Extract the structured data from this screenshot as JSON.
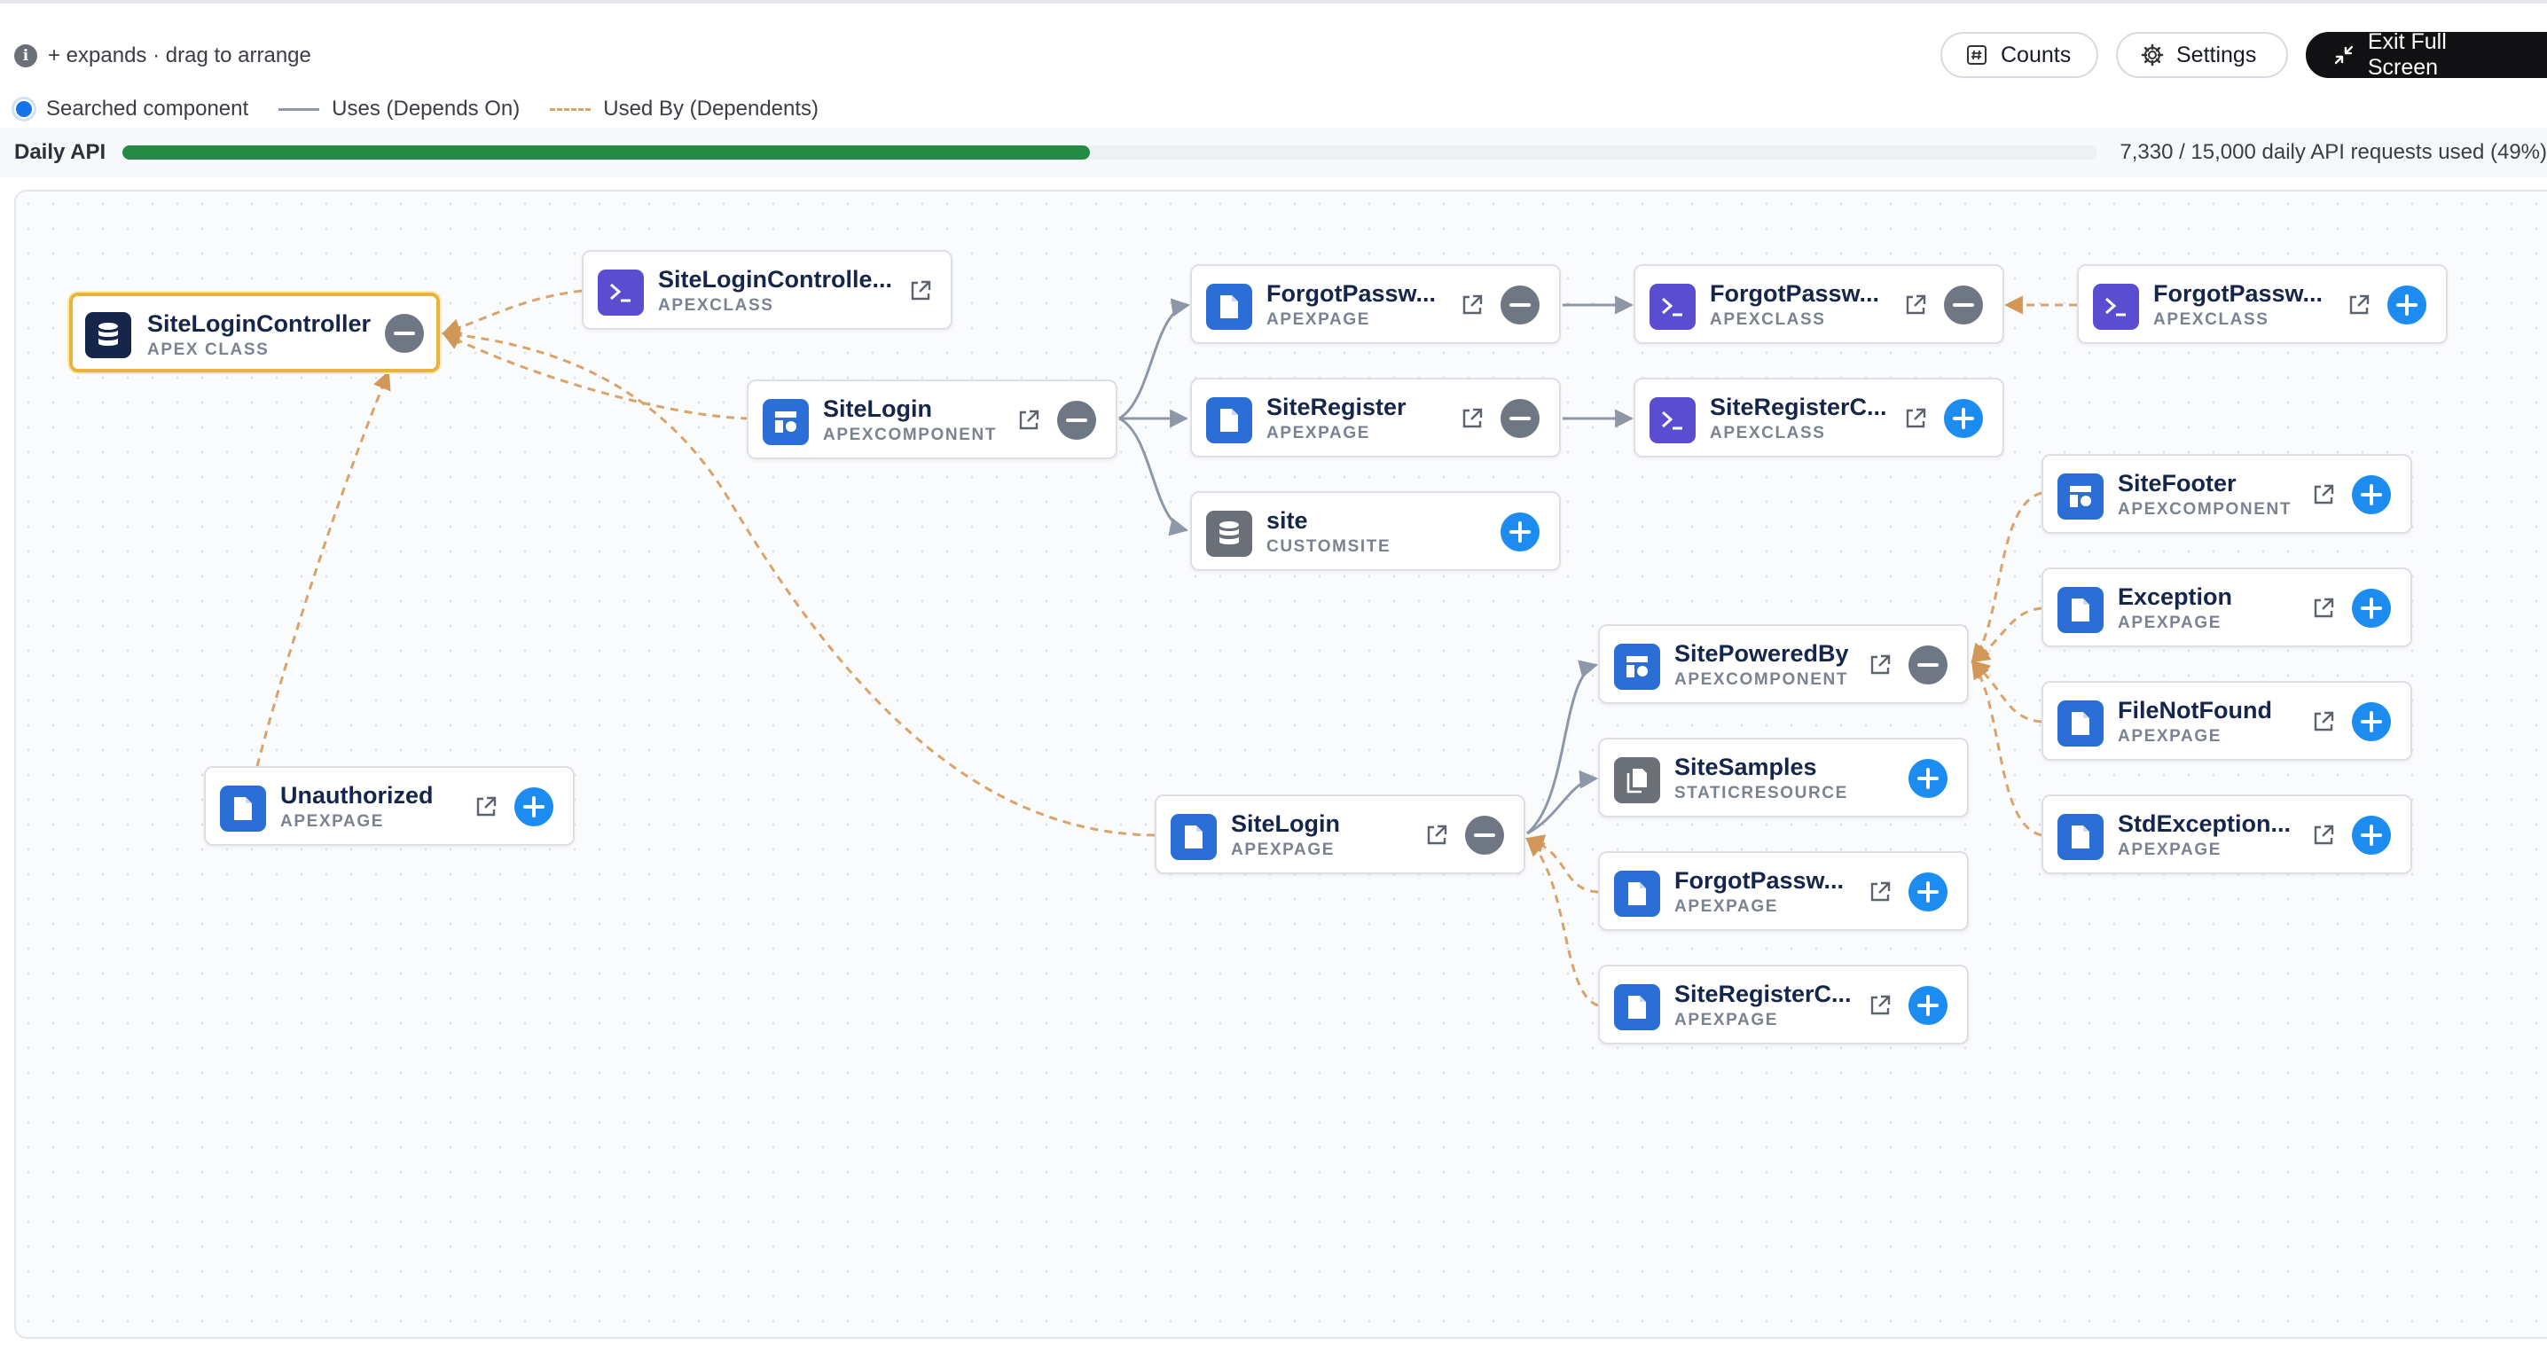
{
  "hint": {
    "text": "+ expands · drag to arrange"
  },
  "legend": {
    "searched": "Searched component",
    "uses": "Uses (Depends On)",
    "used_by": "Used By (Dependents)"
  },
  "toolbar": {
    "counts_label": "Counts",
    "settings_label": "Settings",
    "exit_label": "Exit Full Screen"
  },
  "api": {
    "label": "Daily API",
    "usage_fraction": 0.49,
    "usage_text": "7,330 / 15,000 daily API requests used (49%)"
  },
  "colors": {
    "uses_edge": "#8d97a8",
    "used_by_edge": "#d9a46a",
    "searched_border": "#e8b53a",
    "expand_button": "#1c8cf0",
    "collapse_button": "#6f7785",
    "api_bar": "#258a45"
  },
  "nodes": {
    "searched": {
      "name": "SiteLoginController",
      "type": "APEX CLASS",
      "icon": "database-icon"
    },
    "controller_class": {
      "name": "SiteLoginControlle...",
      "type": "APEXCLASS",
      "icon": "terminal-icon"
    },
    "sitelogin_component": {
      "name": "SiteLogin",
      "type": "APEXCOMPONENT",
      "icon": "component-icon"
    },
    "forgot_page": {
      "name": "ForgotPassw...",
      "type": "APEXPAGE",
      "icon": "page-icon"
    },
    "forgot_class": {
      "name": "ForgotPassw...",
      "type": "APEXCLASS",
      "icon": "terminal-icon"
    },
    "forgot_test_class": {
      "name": "ForgotPassw...",
      "type": "APEXCLASS",
      "icon": "terminal-icon"
    },
    "register_page": {
      "name": "SiteRegister",
      "type": "APEXPAGE",
      "icon": "page-icon"
    },
    "register_class": {
      "name": "SiteRegisterC...",
      "type": "APEXCLASS",
      "icon": "terminal-icon"
    },
    "site": {
      "name": "site",
      "type": "CUSTOMSITE",
      "icon": "database-icon"
    },
    "footer": {
      "name": "SiteFooter",
      "type": "APEXCOMPONENT",
      "icon": "component-icon"
    },
    "exception": {
      "name": "Exception",
      "type": "APEXPAGE",
      "icon": "page-icon"
    },
    "poweredby": {
      "name": "SitePoweredBy",
      "type": "APEXCOMPONENT",
      "icon": "component-icon"
    },
    "filenotfound": {
      "name": "FileNotFound",
      "type": "APEXPAGE",
      "icon": "page-icon"
    },
    "samples": {
      "name": "SiteSamples",
      "type": "STATICRESOURCE",
      "icon": "files-icon"
    },
    "unauthorized": {
      "name": "Unauthorized",
      "type": "APEXPAGE",
      "icon": "page-icon"
    },
    "sitelogin_page": {
      "name": "SiteLogin",
      "type": "APEXPAGE",
      "icon": "page-icon"
    },
    "stdexception": {
      "name": "StdException...",
      "type": "APEXPAGE",
      "icon": "page-icon"
    },
    "forgot_page2": {
      "name": "ForgotPassw...",
      "type": "APEXPAGE",
      "icon": "page-icon"
    },
    "register_page2": {
      "name": "SiteRegisterC...",
      "type": "APEXPAGE",
      "icon": "page-icon"
    }
  }
}
